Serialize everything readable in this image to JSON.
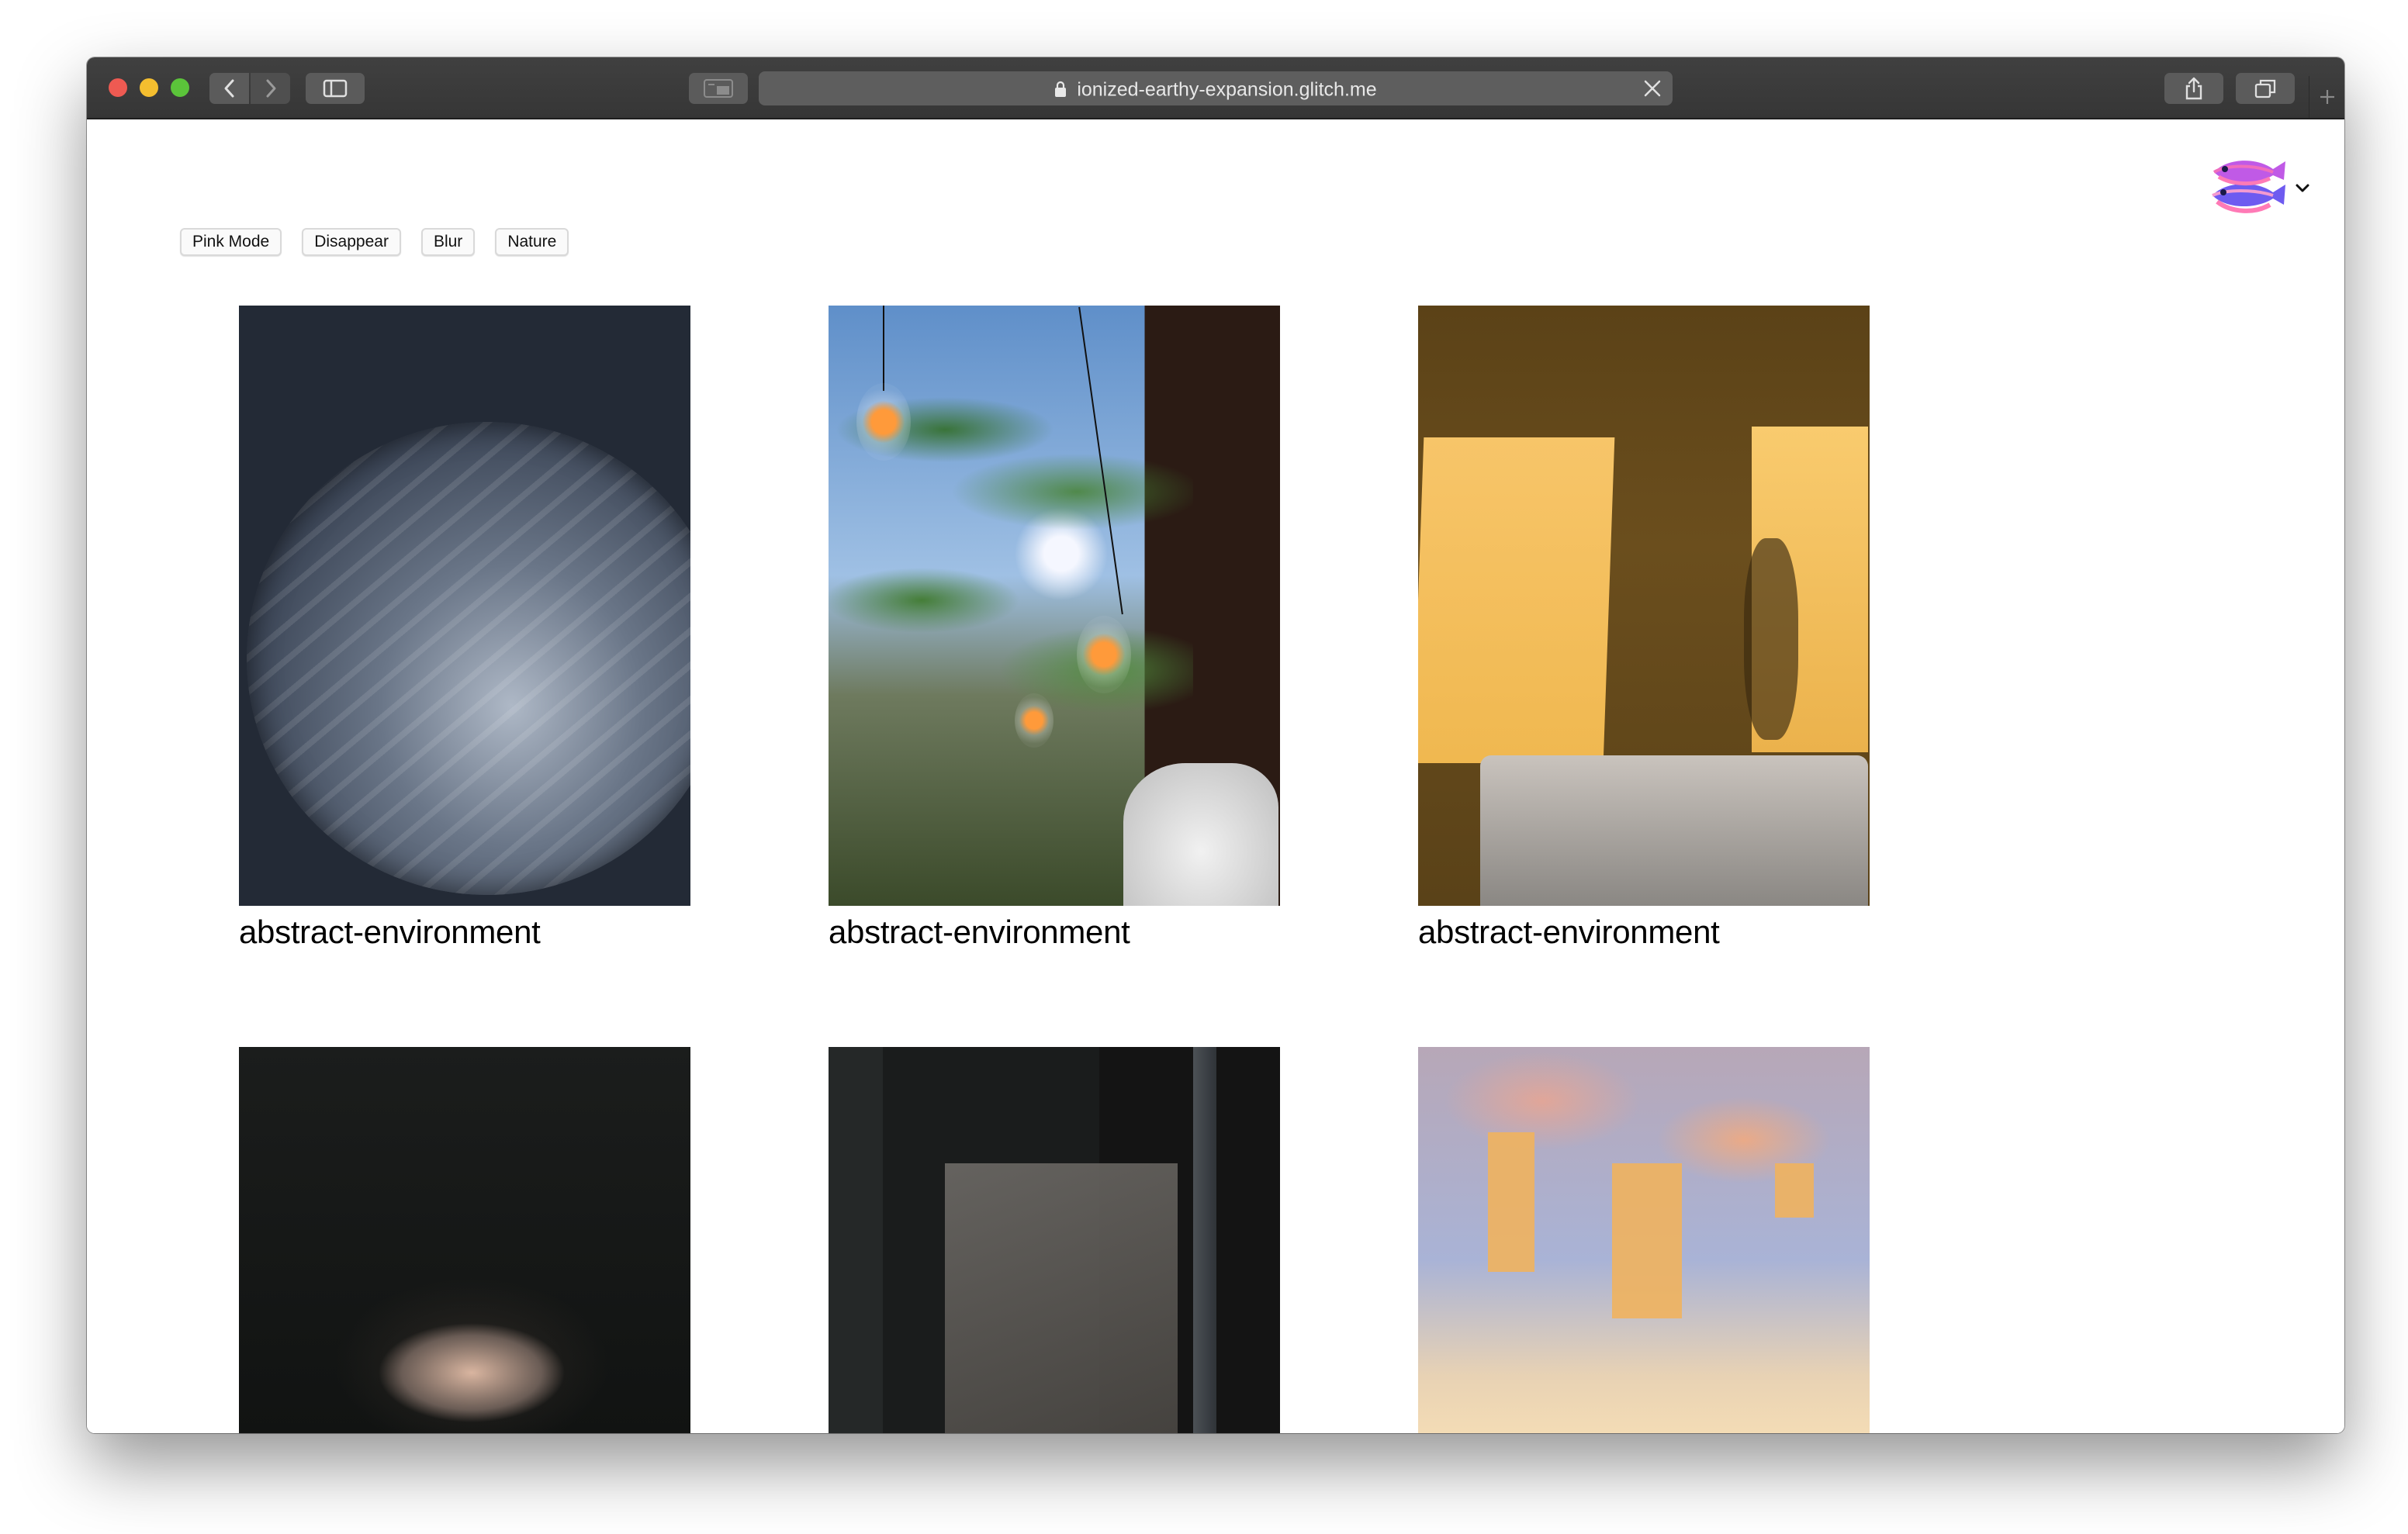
{
  "browser": {
    "url": "ionized-earthy-expansion.glitch.me"
  },
  "controls": [
    {
      "label": "Pink Mode"
    },
    {
      "label": "Disappear"
    },
    {
      "label": "Blur"
    },
    {
      "label": "Nature"
    }
  ],
  "gallery": [
    {
      "caption": "abstract-environment"
    },
    {
      "caption": "abstract-environment"
    },
    {
      "caption": "abstract-environment"
    },
    {
      "caption": ""
    },
    {
      "caption": ""
    },
    {
      "caption": ""
    }
  ],
  "colors": {
    "titlebar": "#3a3a3a",
    "page_background": "#ffffff",
    "button_border": "#d9d9d9"
  },
  "icons": [
    "lock-icon",
    "chevron-left-icon",
    "chevron-right-icon",
    "sidebar-icon",
    "reader-icon",
    "close-icon",
    "share-icon",
    "tabs-icon",
    "plus-icon",
    "fish-logo-icon",
    "chevron-down-icon"
  ]
}
